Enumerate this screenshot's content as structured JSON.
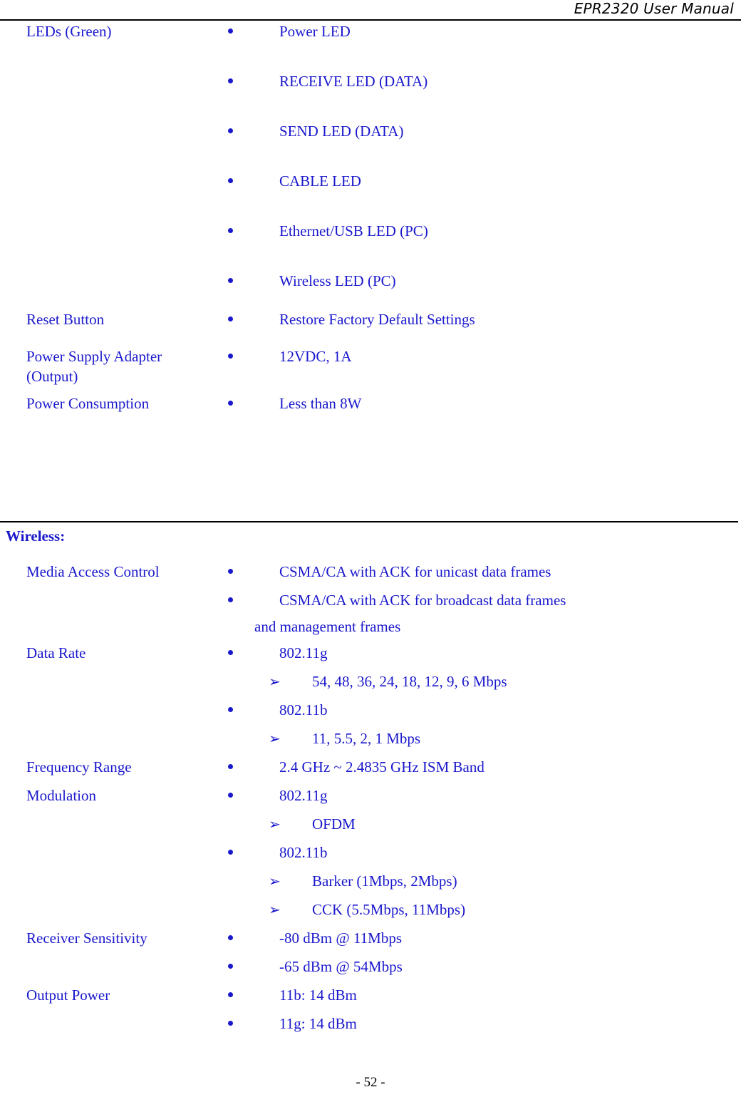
{
  "header": {
    "title": "EPR2320 User Manual"
  },
  "colors": {
    "text_blue": "#1a18cc",
    "rule_black": "#000000",
    "page_background": "#ffffff"
  },
  "hardware_section": {
    "rows": [
      {
        "label": "LEDs (Green)",
        "bullets": [
          "Power LED",
          "RECEIVE LED (DATA)",
          "SEND LED (DATA)",
          "CABLE LED",
          "Ethernet/USB LED (PC)",
          "Wireless LED (PC)"
        ]
      },
      {
        "label": "Reset Button",
        "bullets": [
          "Restore Factory Default Settings"
        ]
      },
      {
        "label": "Power Supply Adapter (Output)",
        "label_line1": "Power Supply Adapter",
        "label_line2": "(Output)",
        "bullets": [
          "12VDC, 1A"
        ]
      },
      {
        "label": "Power Consumption",
        "bullets": [
          "Less than 8W"
        ]
      }
    ]
  },
  "wireless_section": {
    "heading": "Wireless:",
    "rows": [
      {
        "label": "Media Access Control",
        "bullets": [
          "CSMA/CA with ACK for unicast data frames",
          "CSMA/CA with ACK for broadcast data frames"
        ],
        "continuation": "and management frames"
      },
      {
        "label": "Data Rate",
        "bullet_g": "802.11g",
        "arrow_g": "54, 48, 36, 24, 18, 12, 9, 6 Mbps",
        "bullet_b": "802.11b",
        "arrow_b": "11, 5.5, 2, 1 Mbps"
      },
      {
        "label": "Frequency Range",
        "bullets": [
          "2.4 GHz ~ 2.4835 GHz ISM Band"
        ]
      },
      {
        "label": "Modulation",
        "bullet_g": "802.11g",
        "arrow_g": "OFDM",
        "bullet_b": "802.11b",
        "arrow_b1": "Barker (1Mbps, 2Mbps)",
        "arrow_b2": "CCK (5.5Mbps, 11Mbps)"
      },
      {
        "label": "Receiver Sensitivity",
        "bullets": [
          "-80 dBm @ 11Mbps",
          "-65 dBm @ 54Mbps"
        ]
      },
      {
        "label": "Output Power",
        "bullets": [
          "11b: 14 dBm",
          "11g: 14 dBm"
        ]
      }
    ]
  },
  "icons": {
    "bullet_dot": "•",
    "arrow_bullet": "➢"
  },
  "footer": {
    "page_number": "- 52 -"
  }
}
